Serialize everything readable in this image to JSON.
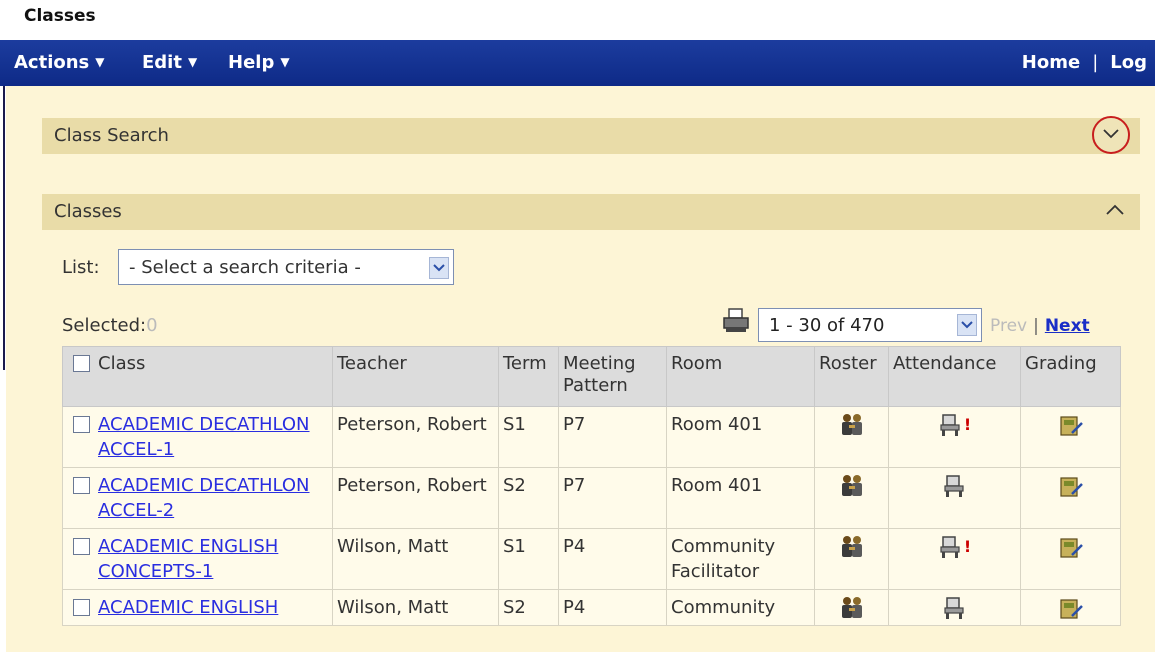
{
  "window": {
    "title": "Classes"
  },
  "menubar": {
    "menus": [
      "Actions",
      "Edit",
      "Help"
    ],
    "home": "Home",
    "separator": "|",
    "log": "Log"
  },
  "class_search": {
    "title": "Class Search"
  },
  "classes_panel": {
    "title": "Classes"
  },
  "list": {
    "label": "List:",
    "value": "- Select a search criteria -"
  },
  "selected": {
    "label": "Selected:",
    "count": "0"
  },
  "pager": {
    "range": "1 - 30 of 470",
    "prev": "Prev",
    "separator": "|",
    "next": "Next"
  },
  "table": {
    "headers": [
      "Class",
      "Teacher",
      "Term",
      "Meeting Pattern",
      "Room",
      "Roster",
      "Attendance",
      "Grading"
    ],
    "rows": [
      {
        "class": "ACADEMIC DECATHLON ACCEL-1",
        "teacher": "Peterson, Robert",
        "term": "S1",
        "meeting": "P7",
        "room": "Room 401",
        "attendance_alert": "!"
      },
      {
        "class": "ACADEMIC DECATHLON ACCEL-2",
        "teacher": "Peterson, Robert",
        "term": "S2",
        "meeting": "P7",
        "room": "Room 401",
        "attendance_alert": ""
      },
      {
        "class": "ACADEMIC ENGLISH CONCEPTS-1",
        "teacher": "Wilson, Matt",
        "term": "S1",
        "meeting": "P4",
        "room": "Community Facilitator",
        "attendance_alert": "!"
      },
      {
        "class": "ACADEMIC ENGLISH",
        "teacher": "Wilson, Matt",
        "term": "S2",
        "meeting": "P4",
        "room": "Community",
        "attendance_alert": ""
      }
    ]
  },
  "icons": {
    "menu_caret": "caret-down-icon",
    "expand": "chevron-down-icon",
    "collapse": "chevron-up-icon",
    "print": "printer-icon",
    "roster": "roster-people-icon",
    "attendance": "attendance-seat-icon",
    "grading": "gradebook-icon"
  },
  "colors": {
    "menubar": "#0e2a87",
    "panel_header": "#e9dca8",
    "background": "#fdf5d6",
    "highlight_ring": "#c81e1e",
    "link": "#2a2ee0"
  }
}
